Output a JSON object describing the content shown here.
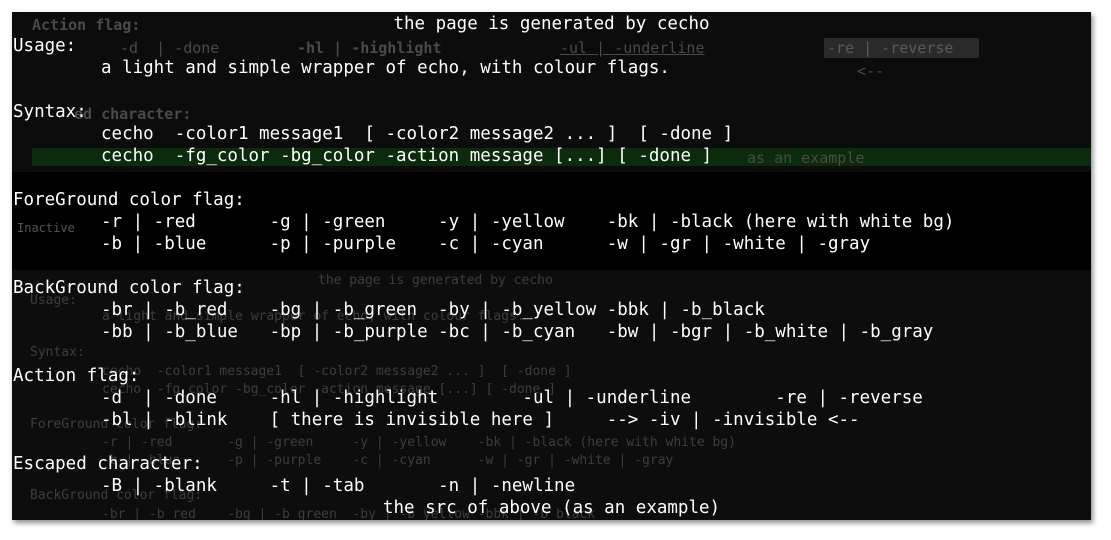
{
  "ghost": {
    "g1": "Action flag:",
    "g2": "-d  | -done",
    "g3": "-hl | -highlight",
    "g4": "-ul | -underline",
    "g5": "-re | -reverse",
    "g6": "<--",
    "g7": "ed character:",
    "g8": "as an example",
    "g9": "Inactive",
    "g10": "the page is generated by cecho",
    "g11": "Usage:",
    "g12": "a light and simple wrapper of echo, with colour flags.",
    "g13": "Syntax:",
    "g14": "cecho  -color1 message1  [ -color2 message2 ... ]  [ -done ]",
    "g15": "cecho  -fg_color -bg_color -action message [...] [ -done ]",
    "g16": "ForeGround color flag:",
    "g17": "-r | -red       -g | -green     -y | -yellow    -bk | -black (here with white bg)",
    "g18": "-b | -blue      -p | -purple    -c | -cyan      -w | -gr | -white | -gray",
    "g19": "BackGround color flag:",
    "g20": "-br | -b_red    -bg | -b_green  -by | -b_yellow -bbk | -b_black"
  },
  "terminal": {
    "header": "the page is generated by cecho",
    "usage_label": "Usage:",
    "usage_text": "a light and simple wrapper of echo, with colour flags.",
    "syntax_label": "Syntax:",
    "syntax_1": "cecho  -color1 message1  [ -color2 message2 ... ]  [ -done ]",
    "syntax_2": "cecho  -fg_color -bg_color -action message [...] [ -done ]",
    "fg_label": "ForeGround color flag:",
    "fg_1": "-r | -red       -g | -green     -y | -yellow    -bk | -black (here with white bg)",
    "fg_2": "-b | -blue      -p | -purple    -c | -cyan      -w | -gr | -white | -gray",
    "bg_label": "BackGround color flag:",
    "bg_1": "-br | -b_red    -bg | -b_green  -by | -b_yellow -bbk | -b_black",
    "bg_2": "-bb | -b_blue   -bp | -b_purple -bc | -b_cyan   -bw | -bgr | -b_white | -b_gray",
    "action_label": "Action flag:",
    "action_1": "-d  | -done     -hl | -highlight        -ul | -underline        -re | -reverse",
    "action_2": "-bl | -blink    [ there is invisible here ]     --> -iv | -invisible <--",
    "escaped_label": "Escaped character:",
    "escaped_1": "-B | -blank     -t | -tab       -n | -newline",
    "footer": "the src of above (as an example)"
  },
  "colors": {
    "background": "#000000",
    "text": "#ffffff",
    "ghost_text": "#4a4a4a",
    "ghost_green": "#0c2a0c"
  }
}
